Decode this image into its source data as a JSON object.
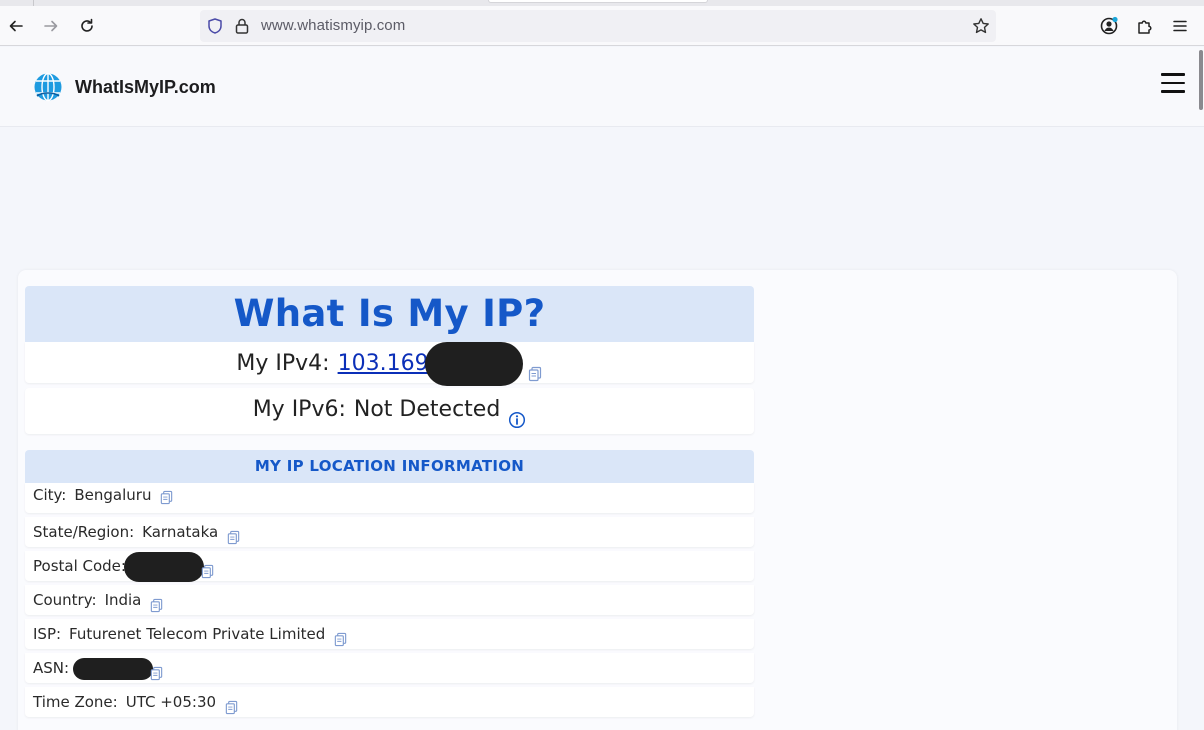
{
  "browser": {
    "url": "www.whatismyip.com"
  },
  "site": {
    "brand": "WhatIsMyIP.com"
  },
  "ip": {
    "title": "What Is My IP?",
    "ipv4_label": "My IPv4:",
    "ipv4_value": "103.169",
    "ipv6_label": "My IPv6:",
    "ipv6_value": "Not Detected"
  },
  "location": {
    "header": "MY IP LOCATION INFORMATION",
    "rows": [
      {
        "label": "City:",
        "value": "Bengaluru"
      },
      {
        "label": "State/Region:",
        "value": "Karnataka"
      },
      {
        "label": "Postal Code:",
        "value": ""
      },
      {
        "label": "Country:",
        "value": "India"
      },
      {
        "label": "ISP:",
        "value": "Futurenet Telecom Private Limited"
      },
      {
        "label": "ASN:",
        "value": ""
      },
      {
        "label": "Time Zone:",
        "value": "UTC +05:30"
      }
    ]
  },
  "colors": {
    "accent": "#1558c8",
    "header_bg": "#dae6f8",
    "link": "#0b2fb8"
  }
}
